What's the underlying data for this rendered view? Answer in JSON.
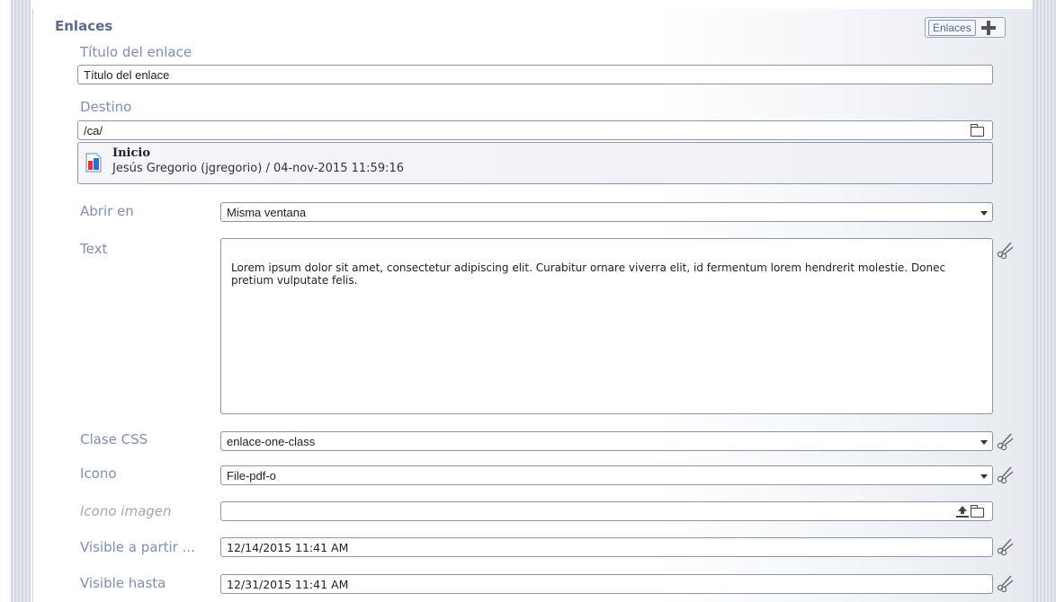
{
  "section": {
    "title": "Enlaces",
    "add_button_label": "Enlaces"
  },
  "link_title": {
    "label": "Título del enlace",
    "value": "Título del enlace"
  },
  "destination": {
    "label": "Destino",
    "value": "/ca/",
    "page_name": "Inicio",
    "page_meta": "Jesús Gregorio (jgregorio) / 04-nov-2015 11:59:16"
  },
  "open_in": {
    "label": "Abrir en",
    "value": "Misma ventana"
  },
  "text": {
    "label": "Text",
    "value": "Lorem ipsum dolor sit amet, consectetur adipiscing elit. Curabitur ornare viverra elit, id fermentum lorem hendrerit molestie. Donec pretium vulputate felis."
  },
  "css_class": {
    "label": "Clase CSS",
    "value": "enlace-one-class"
  },
  "icon": {
    "label": "Icono",
    "value": "File-pdf-o"
  },
  "icon_image": {
    "label": "Icono imagen",
    "value": ""
  },
  "visible_from": {
    "label": "Visible a partir ...",
    "value": "12/14/2015 11:41 AM"
  },
  "visible_until": {
    "label": "Visible hasta",
    "value": "12/31/2015 11:41 AM"
  },
  "icons": {
    "add": "plus-icon",
    "folder": "folder-icon",
    "upload": "upload-icon",
    "clear": "scissors-icon",
    "dropdown": "chevron-down-icon",
    "document": "document-icon"
  },
  "colors": {
    "label": "#7f8fad",
    "title": "#5b6c8b",
    "border": "#8a95a8"
  }
}
